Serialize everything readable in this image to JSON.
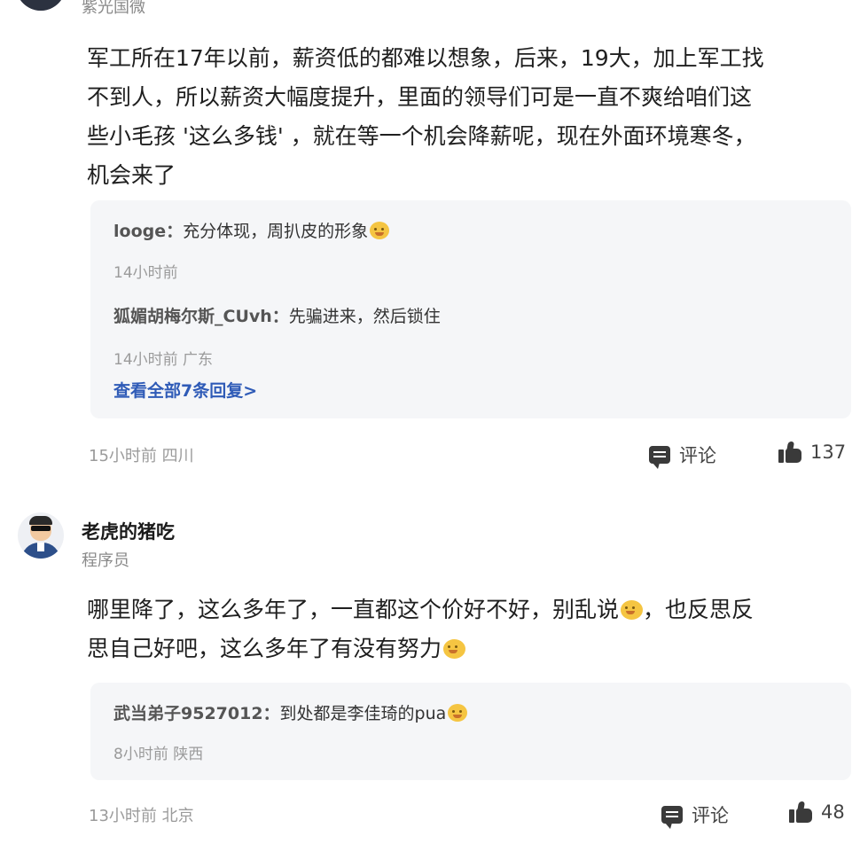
{
  "comment1": {
    "user_subtitle": "紫光国微",
    "body_lines": [
      "军工所在17年以前，薪资低的都难以想象，后来，19大，加上军工找",
      "不到人，所以薪资大幅度提升，里面的领导们可是一直不爽给咱们这",
      "些小毛孩 '这么多钱' ，就在等一个机会降薪呢，现在外面环境寒冬，",
      "机会来了"
    ],
    "replies": [
      {
        "name": "looge：",
        "text": "充分体现，周扒皮的形象",
        "meta": "14小时前"
      },
      {
        "name": "狐媚胡梅尔斯_CUvh：",
        "text": "先骗进来，然后锁住",
        "meta": "14小时前 广东"
      }
    ],
    "see_all": "查看全部7条回复>",
    "meta": "15小时前 四川",
    "comment_label": "评论",
    "like_count": "137"
  },
  "comment2": {
    "username": "老虎的猪吃",
    "user_subtitle": "程序员",
    "body_line1": "哪里降了，这么多年了，一直都这个价好不好，别乱说",
    "body_line1_tail": "，也反思反",
    "body_line2": "思自己好吧，这么多年了有没有努力",
    "reply": {
      "name": "武当弟子9527012：",
      "text": "到处都是李佳琦的pua",
      "meta": "8小时前 陕西"
    },
    "meta": "13小时前 北京",
    "comment_label": "评论",
    "like_count": "48"
  },
  "icons": {
    "avatar": "avatar",
    "comment": "comment-icon",
    "like": "thumbs-up-icon",
    "emoji": "laughing-emoji-icon"
  }
}
